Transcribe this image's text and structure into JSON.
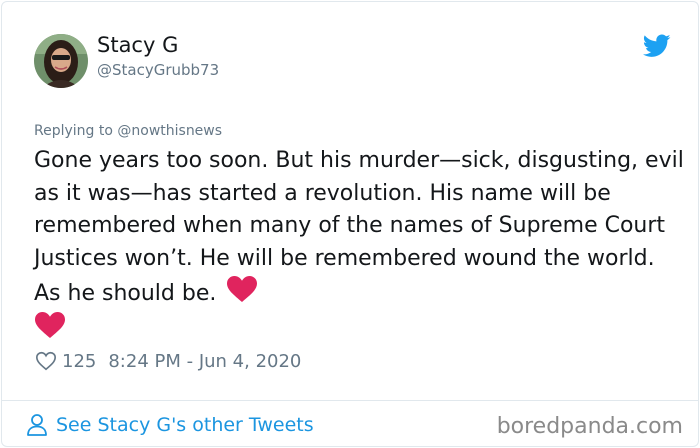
{
  "user": {
    "display_name": "Stacy G",
    "handle": "@StacyGrubb73"
  },
  "tweet": {
    "reply_context": "Replying to @nowthisnews",
    "text": "Gone years too soon. But his murder—sick, disgusting, evil as it was—has started a revolution. His name will be remembered when many of the names of Supreme Court Justices won’t. He will be remembered wound the world. As he should be.",
    "emoji": [
      "red-heart",
      "red-heart"
    ],
    "like_count": "125",
    "timestamp": "8:24 PM - Jun 4, 2020"
  },
  "footer": {
    "see_tweets_label": "See Stacy G's other Tweets",
    "watermark": "boredpanda.com"
  },
  "colors": {
    "twitter_blue": "#1da1f2",
    "link_blue": "#1b95e0",
    "text_primary": "#14171a",
    "text_secondary": "#657786",
    "heart_red": "#e0245e",
    "divider": "#e1e8ed"
  }
}
